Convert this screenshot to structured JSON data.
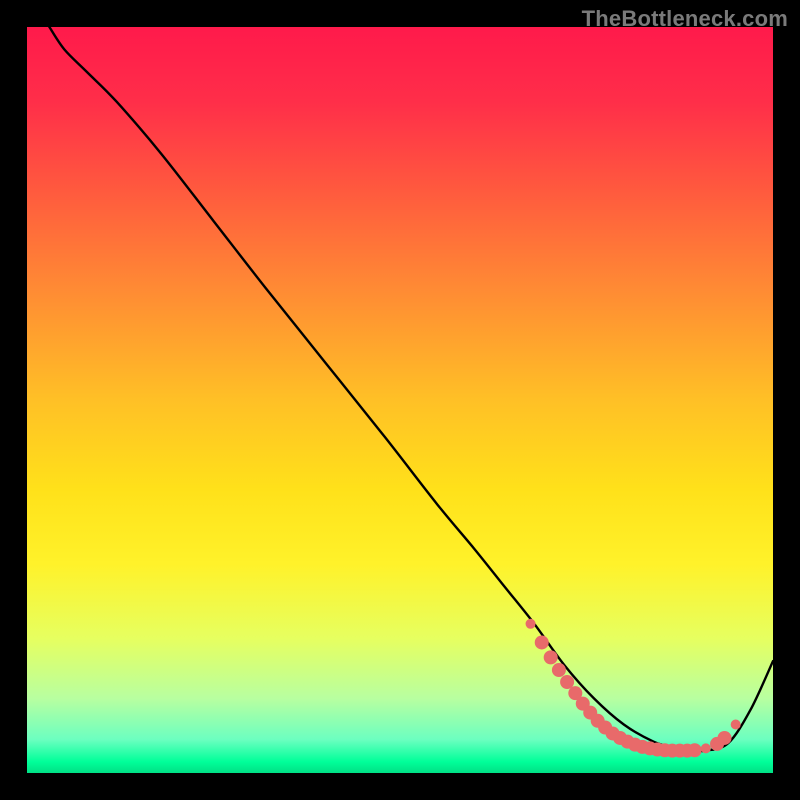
{
  "watermark": "TheBottleneck.com",
  "gradient_stops": [
    {
      "offset": 0.0,
      "color": "#ff1a4b"
    },
    {
      "offset": 0.1,
      "color": "#ff2e49"
    },
    {
      "offset": 0.22,
      "color": "#ff5a3e"
    },
    {
      "offset": 0.35,
      "color": "#ff8a34"
    },
    {
      "offset": 0.5,
      "color": "#ffc026"
    },
    {
      "offset": 0.62,
      "color": "#ffe11a"
    },
    {
      "offset": 0.72,
      "color": "#fff22a"
    },
    {
      "offset": 0.82,
      "color": "#e6ff60"
    },
    {
      "offset": 0.9,
      "color": "#b8ffa0"
    },
    {
      "offset": 0.955,
      "color": "#6cffc0"
    },
    {
      "offset": 0.985,
      "color": "#00ff99"
    },
    {
      "offset": 1.0,
      "color": "#00e085"
    }
  ],
  "curve_color": "#000000",
  "curve_width": 2.4,
  "marker_color": "#e86a6a",
  "marker_radius_small": 5,
  "marker_radius_large": 7,
  "chart_data": {
    "type": "line",
    "title": "",
    "xlabel": "",
    "ylabel": "",
    "xlim": [
      0,
      100
    ],
    "ylim": [
      0,
      100
    ],
    "grid": false,
    "legend": false,
    "series": [
      {
        "name": "curve",
        "x": [
          3,
          5,
          8,
          12,
          18,
          25,
          32,
          40,
          48,
          55,
          60,
          64,
          68,
          72,
          76,
          80,
          84,
          87,
          89,
          91,
          94,
          97,
          100
        ],
        "y": [
          100,
          97,
          94,
          90,
          83,
          74,
          65,
          55,
          45,
          36,
          30,
          25,
          20,
          14.5,
          10,
          6.5,
          4.2,
          3.3,
          3.0,
          3.0,
          4.0,
          8.5,
          15
        ]
      }
    ],
    "markers": [
      {
        "x": 67.5,
        "y": 20.0,
        "size": "small"
      },
      {
        "x": 69.0,
        "y": 17.5,
        "size": "large"
      },
      {
        "x": 70.2,
        "y": 15.5,
        "size": "large"
      },
      {
        "x": 71.3,
        "y": 13.8,
        "size": "large"
      },
      {
        "x": 72.4,
        "y": 12.2,
        "size": "large"
      },
      {
        "x": 73.5,
        "y": 10.7,
        "size": "large"
      },
      {
        "x": 74.5,
        "y": 9.3,
        "size": "large"
      },
      {
        "x": 75.5,
        "y": 8.1,
        "size": "large"
      },
      {
        "x": 76.5,
        "y": 7.0,
        "size": "large"
      },
      {
        "x": 77.5,
        "y": 6.1,
        "size": "large"
      },
      {
        "x": 78.5,
        "y": 5.3,
        "size": "large"
      },
      {
        "x": 79.5,
        "y": 4.7,
        "size": "large"
      },
      {
        "x": 80.5,
        "y": 4.2,
        "size": "large"
      },
      {
        "x": 81.5,
        "y": 3.8,
        "size": "large"
      },
      {
        "x": 82.5,
        "y": 3.5,
        "size": "large"
      },
      {
        "x": 83.5,
        "y": 3.3,
        "size": "large"
      },
      {
        "x": 84.5,
        "y": 3.15,
        "size": "large"
      },
      {
        "x": 85.5,
        "y": 3.05,
        "size": "large"
      },
      {
        "x": 86.5,
        "y": 3.0,
        "size": "large"
      },
      {
        "x": 87.5,
        "y": 3.0,
        "size": "large"
      },
      {
        "x": 88.5,
        "y": 3.0,
        "size": "large"
      },
      {
        "x": 89.5,
        "y": 3.05,
        "size": "large"
      },
      {
        "x": 91.0,
        "y": 3.3,
        "size": "small"
      },
      {
        "x": 92.5,
        "y": 3.9,
        "size": "large"
      },
      {
        "x": 93.5,
        "y": 4.7,
        "size": "large"
      },
      {
        "x": 95.0,
        "y": 6.5,
        "size": "small"
      }
    ]
  }
}
